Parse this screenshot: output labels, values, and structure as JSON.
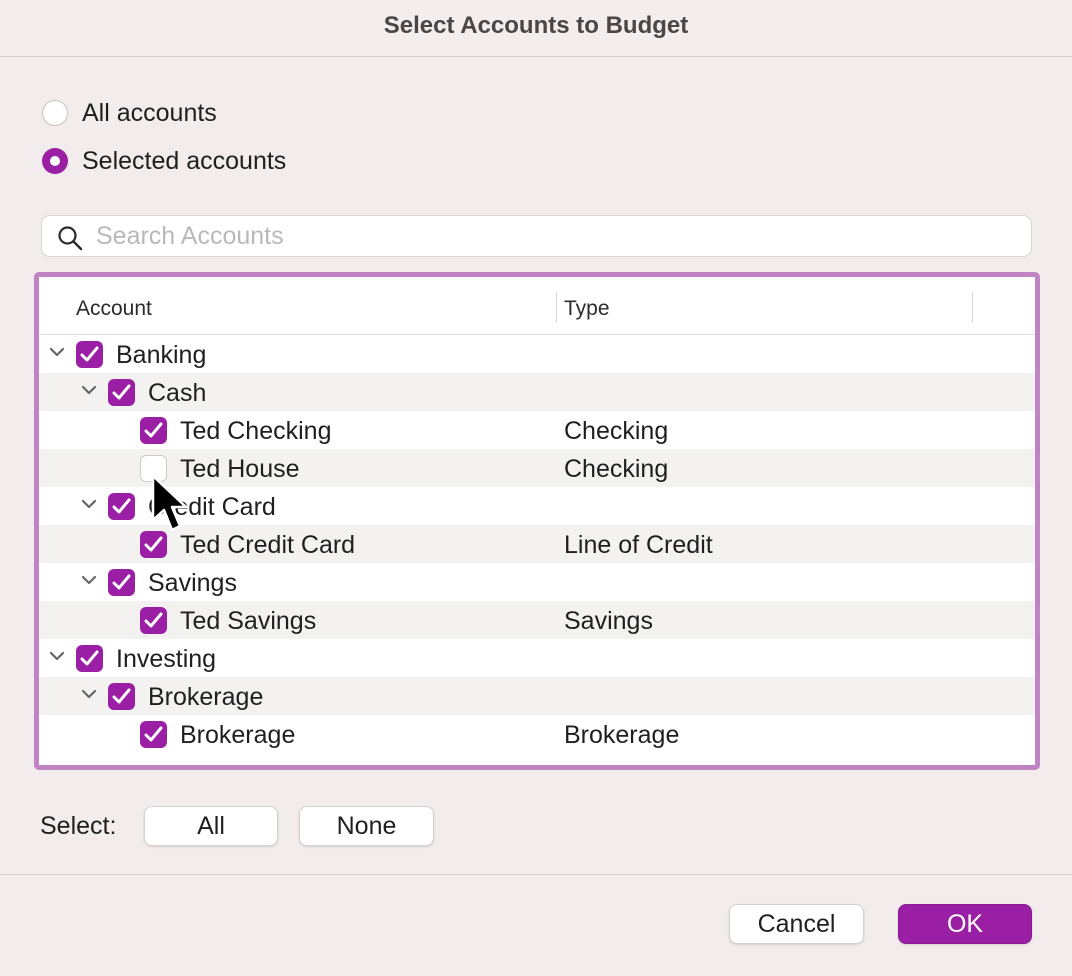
{
  "window": {
    "title": "Select Accounts to Budget"
  },
  "scope": {
    "options": [
      {
        "label": "All accounts",
        "selected": false
      },
      {
        "label": "Selected accounts",
        "selected": true
      }
    ]
  },
  "search": {
    "placeholder": "Search Accounts",
    "value": "",
    "icon": "search-icon"
  },
  "table": {
    "columns": [
      "Account",
      "Type"
    ],
    "rows": [
      {
        "label": "Banking",
        "type": "",
        "level": 0,
        "expanded": true,
        "checked": true
      },
      {
        "label": "Cash",
        "type": "",
        "level": 1,
        "expanded": true,
        "checked": true
      },
      {
        "label": "Ted Checking",
        "type": "Checking",
        "level": 2,
        "checked": true
      },
      {
        "label": "Ted House",
        "type": "Checking",
        "level": 2,
        "checked": false
      },
      {
        "label": "Credit Card",
        "type": "",
        "level": 1,
        "expanded": true,
        "checked": true
      },
      {
        "label": "Ted Credit Card",
        "type": "Line of Credit",
        "level": 2,
        "checked": true
      },
      {
        "label": "Savings",
        "type": "",
        "level": 1,
        "expanded": true,
        "checked": true
      },
      {
        "label": "Ted Savings",
        "type": "Savings",
        "level": 2,
        "checked": true
      },
      {
        "label": "Investing",
        "type": "",
        "level": 0,
        "expanded": true,
        "checked": true
      },
      {
        "label": "Brokerage",
        "type": "",
        "level": 1,
        "expanded": true,
        "checked": true
      },
      {
        "label": "Brokerage",
        "type": "Brokerage",
        "level": 2,
        "checked": true
      }
    ]
  },
  "select_bar": {
    "label": "Select:",
    "all_label": "All",
    "none_label": "None"
  },
  "footer": {
    "cancel_label": "Cancel",
    "ok_label": "OK"
  },
  "colors": {
    "accent": "#9a1fa5",
    "focus_ring": "#c084c4",
    "background": "#f2ecec"
  }
}
